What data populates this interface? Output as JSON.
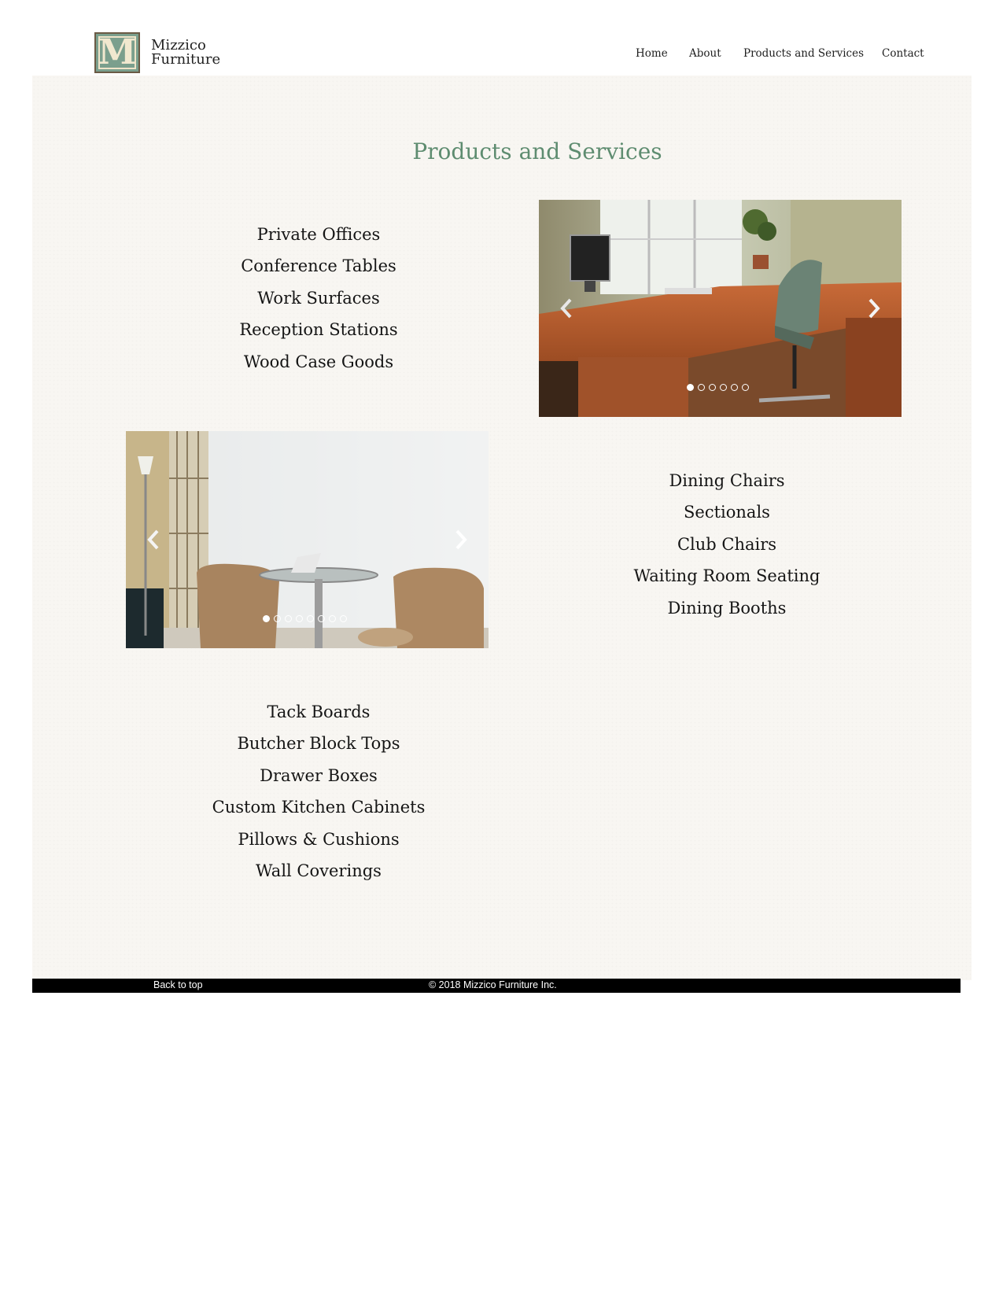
{
  "brand": {
    "logo_letter": "M",
    "name_line1": "Mizzico",
    "name_line2": "Furniture",
    "logo_color": "#7b9f8d"
  },
  "nav": {
    "home": "Home",
    "about": "About",
    "products": "Products and Services",
    "contact": "Contact"
  },
  "page": {
    "title": "Products and Services",
    "title_color": "#5e8c70"
  },
  "office_list": [
    "Private Offices",
    "Conference Tables",
    "Work Surfaces",
    "Reception Stations",
    "Wood Case Goods"
  ],
  "seating_list": [
    "Dining Chairs",
    "Sectionals",
    "Club Chairs",
    "Waiting Room Seating",
    "Dining Booths"
  ],
  "other_list": [
    "Tack Boards",
    "Butcher Block Tops",
    "Drawer Boxes",
    "Custom Kitchen Cabinets",
    "Pillows & Cushions",
    "Wall Coverings"
  ],
  "carousels": {
    "office": {
      "slide_count": 6,
      "active_slide": 1,
      "prev_icon": "chevron-left-icon",
      "next_icon": "chevron-right-icon"
    },
    "lounge": {
      "slide_count": 8,
      "active_slide": 1,
      "prev_icon": "chevron-left-icon",
      "next_icon": "chevron-right-icon"
    }
  },
  "footer": {
    "back_to_top": "Back to top",
    "copyright": "© 2018 Mizzico Furniture Inc."
  }
}
